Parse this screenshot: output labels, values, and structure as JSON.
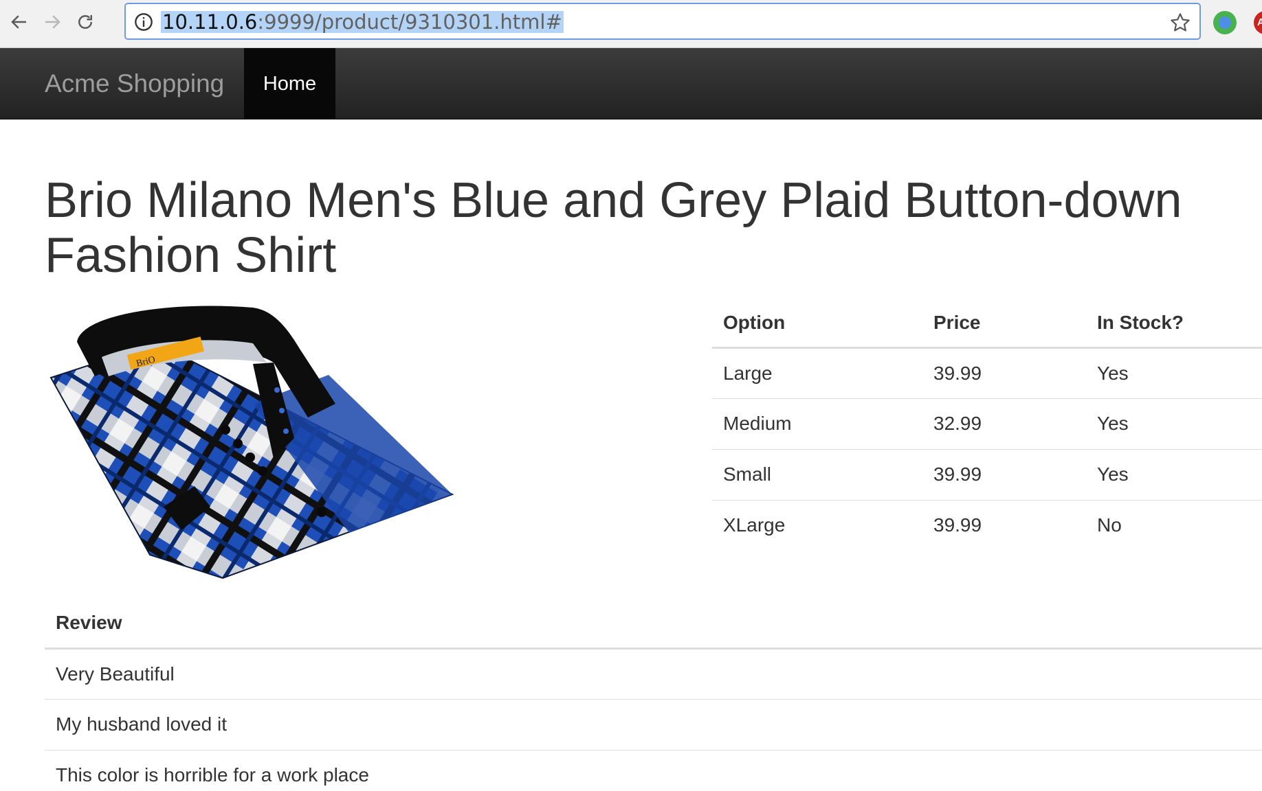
{
  "browser": {
    "url_host": "10.11.0.6",
    "url_path": ":9999/product/9310301.html#",
    "back_icon": "arrow-left-icon",
    "forward_icon": "arrow-right-icon",
    "reload_icon": "reload-icon",
    "info_icon": "info-icon",
    "bookmark_icon": "star-icon",
    "extension_badge": "A"
  },
  "navbar": {
    "brand": "Acme Shopping",
    "items": [
      {
        "label": "Home",
        "active": true
      }
    ]
  },
  "product": {
    "title": "Brio Milano Men's Blue and Grey Plaid Button-down Fashion Shirt",
    "image_label_text": "BriO",
    "image_description": "shirt-image"
  },
  "options_table": {
    "headers": [
      "Option",
      "Price",
      "In Stock?"
    ],
    "rows": [
      [
        "Large",
        "39.99",
        "Yes"
      ],
      [
        "Medium",
        "32.99",
        "Yes"
      ],
      [
        "Small",
        "39.99",
        "Yes"
      ],
      [
        "XLarge",
        "39.99",
        "No"
      ]
    ]
  },
  "reviews_table": {
    "header": "Review",
    "rows": [
      "Very Beautiful",
      "My husband loved it",
      "This color is horrible for a work place"
    ]
  },
  "colors": {
    "navbar_bg": "#222222",
    "active_nav_bg": "#080808",
    "brand_text": "#9d9d9d",
    "url_highlight": "#b4d4f7",
    "shirt_blue": "#1e4fb8"
  }
}
